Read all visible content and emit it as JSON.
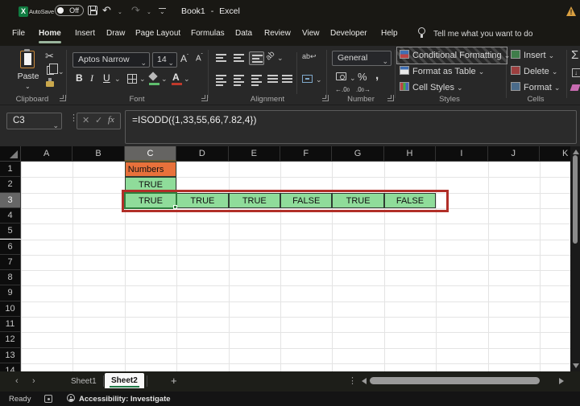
{
  "titlebar": {
    "autosave_label": "AutoSave",
    "autosave_state": "Off",
    "title": "Book1 - Excel"
  },
  "colors": {
    "excel_brand_green": "#107c41",
    "cell_fill_orange": "#e8713b",
    "cell_fill_green": "#8fdc9a",
    "annotation_red": "#b12f28",
    "active_tab_underline_green": "#1f7a47",
    "selection_border_green": "#2f7d3d"
  },
  "menubar": {
    "items": [
      "File",
      "Home",
      "Insert",
      "Draw",
      "Page Layout",
      "Formulas",
      "Data",
      "Review",
      "View",
      "Developer",
      "Help"
    ],
    "active_item": "Home",
    "search_text": "Tell me what you want to do"
  },
  "ribbon": {
    "paste_label": "Paste",
    "font_name": "Aptos Narrow",
    "font_size": "14",
    "number_format": "General",
    "style_buttons": [
      "Conditional Formatting",
      "Format as Table",
      "Cell Styles"
    ],
    "cell_buttons": [
      "Insert",
      "Delete",
      "Format"
    ],
    "group_labels": [
      "Clipboard",
      "Font",
      "Alignment",
      "Number",
      "Styles",
      "Cells"
    ]
  },
  "formula_bar": {
    "name_box": "C3",
    "formula": "=ISODD({1,33,55,66,7.82,4})"
  },
  "grid": {
    "columns": [
      "A",
      "B",
      "C",
      "D",
      "E",
      "F",
      "G",
      "H",
      "I",
      "J",
      "K"
    ],
    "row_count": 14,
    "selected_column": "C",
    "selected_row": 3,
    "cells": [
      {
        "ref": "C1",
        "text": "Numbers",
        "bg": "#e8713b",
        "align": "left",
        "col": 2,
        "row": 1,
        "bordered": true
      },
      {
        "ref": "C2",
        "text": "TRUE",
        "bg": "#8fdc9a",
        "align": "center",
        "col": 2,
        "row": 2,
        "bordered": true
      },
      {
        "ref": "C3",
        "text": "TRUE",
        "bg": "#8fdc9a",
        "align": "center",
        "col": 2,
        "row": 3,
        "bordered": true
      },
      {
        "ref": "D3",
        "text": "TRUE",
        "bg": "#8fdc9a",
        "align": "center",
        "col": 3,
        "row": 3,
        "bordered": true
      },
      {
        "ref": "E3",
        "text": "TRUE",
        "bg": "#8fdc9a",
        "align": "center",
        "col": 4,
        "row": 3,
        "bordered": true
      },
      {
        "ref": "F3",
        "text": "FALSE",
        "bg": "#8fdc9a",
        "align": "center",
        "col": 5,
        "row": 3,
        "bordered": true
      },
      {
        "ref": "G3",
        "text": "TRUE",
        "bg": "#8fdc9a",
        "align": "center",
        "col": 6,
        "row": 3,
        "bordered": true
      },
      {
        "ref": "H3",
        "text": "FALSE",
        "bg": "#8fdc9a",
        "align": "center",
        "col": 7,
        "row": 3,
        "bordered": true
      }
    ],
    "active_cell": "C3"
  },
  "sheet_tabs": {
    "tabs": [
      "Sheet1",
      "Sheet2"
    ],
    "active_tab": "Sheet2",
    "add_label": "+"
  },
  "status_bar": {
    "mode": "Ready",
    "accessibility": "Accessibility: Investigate"
  }
}
